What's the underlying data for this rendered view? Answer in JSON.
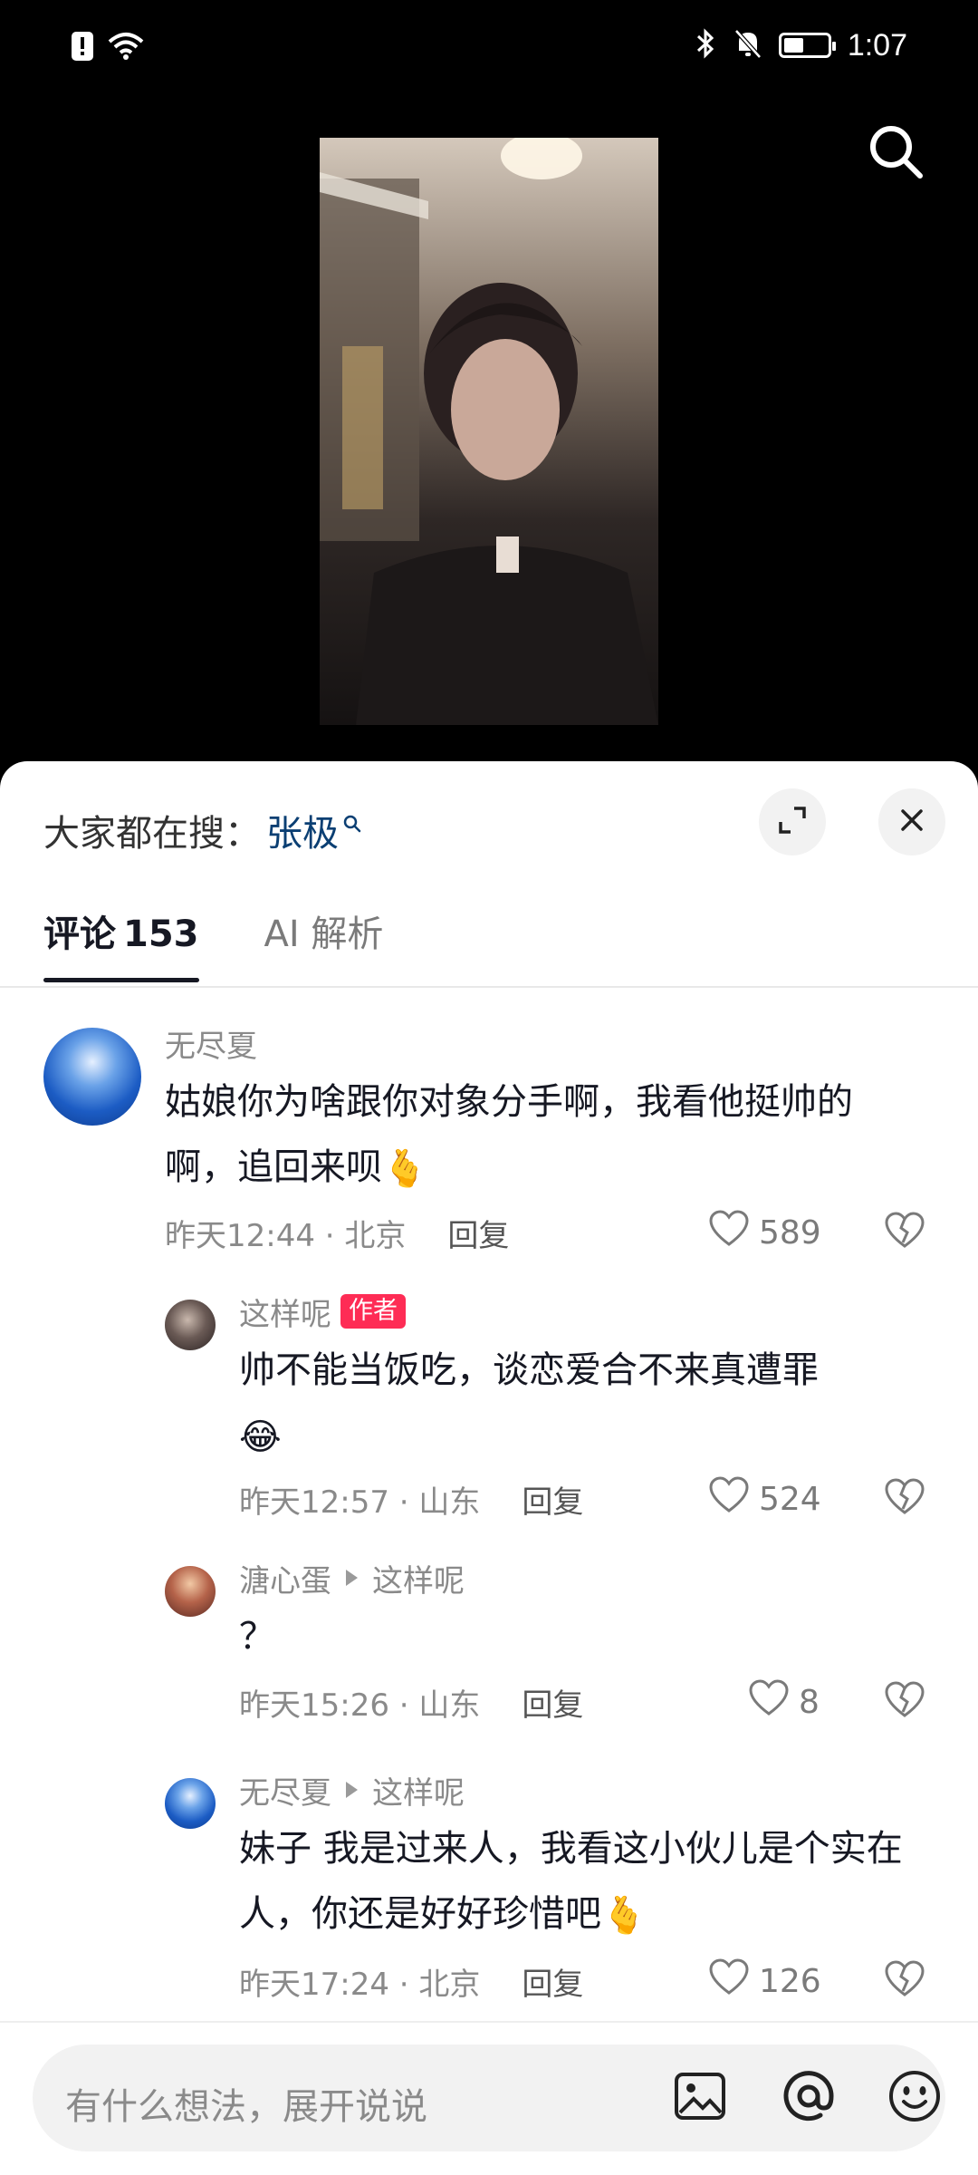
{
  "status_bar": {
    "time": "1:07",
    "battery_level": 0.45
  },
  "hot_search": {
    "label": "大家都在搜：",
    "term": "张极"
  },
  "tabs": [
    {
      "label": "评论",
      "count": "153"
    },
    {
      "label": "AI 解析"
    }
  ],
  "comments": [
    {
      "user": "无尽夏",
      "text": "姑娘你为啥跟你对象分手啊，我看他挺帅的啊，追回来呗",
      "emoji": "🫰",
      "time_location": "昨天12:44 · 北京",
      "reply_label": "回复",
      "likes": "589"
    },
    {
      "user": "这样呢",
      "badge": "作者",
      "text": "帅不能当饭吃，谈恋爱合不来真遭罪",
      "emoji": "😂",
      "time_location": "昨天12:57 · 山东",
      "reply_label": "回复",
      "likes": "524"
    },
    {
      "user": "溏心蛋",
      "reply_to": "这样呢",
      "text": "？",
      "time_location": "昨天15:26 · 山东",
      "reply_label": "回复",
      "likes": "8"
    },
    {
      "user": "无尽夏",
      "reply_to": "这样呢",
      "text": "妹子 我是过来人，我看这小伙儿是个实在人，你还是好好珍惜吧",
      "emoji": "🫰",
      "time_location": "昨天17:24 · 北京",
      "reply_label": "回复",
      "likes": "126"
    }
  ],
  "input": {
    "placeholder": "有什么想法，展开说说"
  },
  "icons": [
    "warning-icon",
    "wifi-icon",
    "bluetooth-icon",
    "mute-icon",
    "battery-icon",
    "search-icon",
    "expand-icon",
    "close-icon",
    "heart-icon",
    "dislike-icon",
    "image-icon",
    "at-icon",
    "emoji-icon"
  ],
  "colors": {
    "accent": "#fe2c55",
    "hot_term": "#0b3f73",
    "text": "#161823",
    "muted": "#8a8a8a"
  }
}
